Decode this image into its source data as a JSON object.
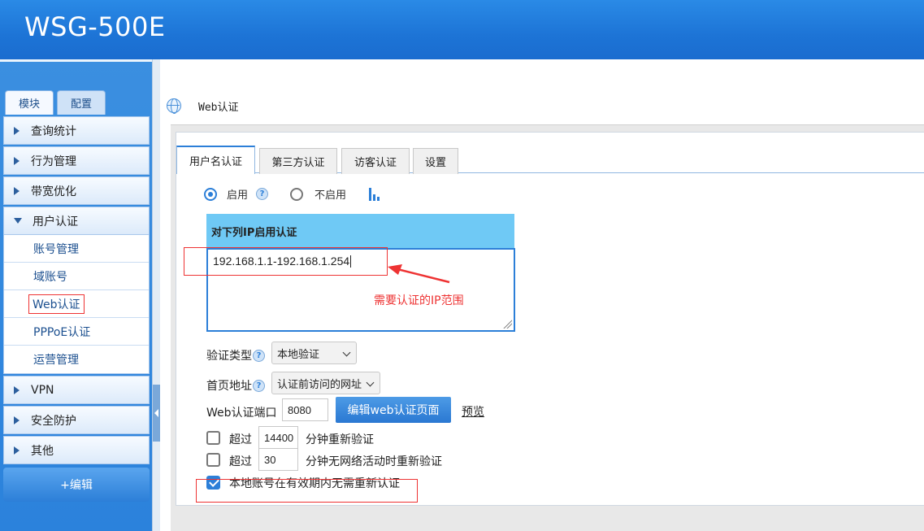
{
  "app": {
    "title": "WSG-500E"
  },
  "sidebar": {
    "tabs": [
      {
        "label": "模块"
      },
      {
        "label": "配置"
      }
    ],
    "items": [
      {
        "label": "查询统计"
      },
      {
        "label": "行为管理"
      },
      {
        "label": "带宽优化"
      },
      {
        "label": "用户认证",
        "expanded": true,
        "children": [
          {
            "label": "账号管理"
          },
          {
            "label": "域账号"
          },
          {
            "label": "Web认证",
            "selected": true
          },
          {
            "label": "PPPoE认证"
          },
          {
            "label": "运营管理"
          }
        ]
      },
      {
        "label": "VPN"
      },
      {
        "label": "安全防护"
      },
      {
        "label": "其他"
      }
    ],
    "edit_label": "+编辑"
  },
  "breadcrumb": {
    "label": "Web认证"
  },
  "tabs": [
    {
      "label": "用户名认证",
      "active": true
    },
    {
      "label": "第三方认证"
    },
    {
      "label": "访客认证"
    },
    {
      "label": "设置"
    }
  ],
  "form": {
    "enable_label": "启用",
    "disable_label": "不启用",
    "enabled": true,
    "ip_header": "对下列IP启用认证",
    "ip_range": "192.168.1.1-192.168.1.254",
    "annotation": "需要认证的IP范围",
    "auth_type_label": "验证类型",
    "auth_type_value": "本地验证",
    "homepage_label": "首页地址",
    "homepage_value": "认证前访问的网址",
    "port_label": "Web认证端口",
    "port_value": "8080",
    "edit_page_button": "编辑web认证页面",
    "preview_link": "预览",
    "reauth": {
      "checked": false,
      "prefix": "超过",
      "minutes": "14400",
      "suffix": "分钟重新验证"
    },
    "idle_reauth": {
      "checked": false,
      "prefix": "超过",
      "minutes": "30",
      "suffix": "分钟无网络活动时重新验证"
    },
    "local_account": {
      "checked": true,
      "label": "本地账号在有效期内无需重新认证"
    }
  },
  "colors": {
    "header": "#1d74d6",
    "accent": "#2c7fd8",
    "ip_header_bg": "#6fc9f5",
    "annotation": "#e33333"
  }
}
